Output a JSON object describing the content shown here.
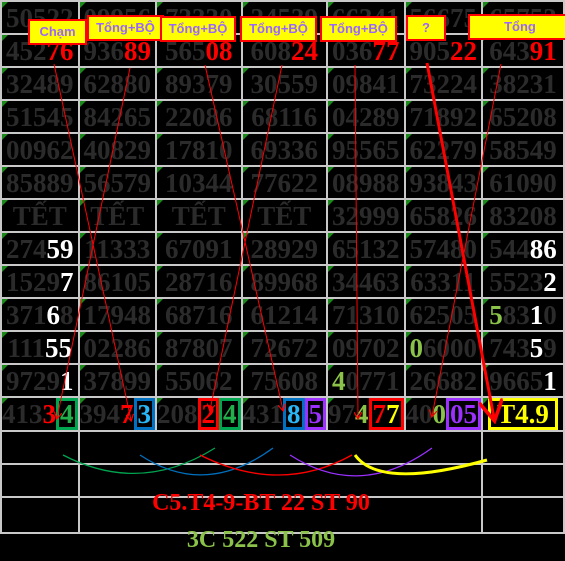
{
  "grid": [
    [
      [
        "50522"
      ],
      [
        "09956"
      ],
      [
        "73330"
      ],
      [
        "24539"
      ],
      [
        "66341"
      ],
      [
        "56675"
      ],
      [
        "65753"
      ]
    ],
    [
      [
        "452",
        ""
      ],
      [
        "936",
        ""
      ],
      [
        "565",
        ""
      ],
      [
        "608",
        ""
      ],
      [
        "036",
        ""
      ],
      [
        "905",
        ""
      ],
      [
        "643",
        ""
      ]
    ],
    [
      [
        "32489"
      ],
      [
        "62880"
      ],
      [
        "89379"
      ],
      [
        "30559"
      ],
      [
        "09841"
      ],
      [
        "73224"
      ],
      [
        "38231"
      ]
    ],
    [
      [
        "51545"
      ],
      [
        "84265"
      ],
      [
        "22086"
      ],
      [
        "68116"
      ],
      [
        "04289"
      ],
      [
        "71892"
      ],
      [
        "65208"
      ]
    ],
    [
      [
        "00962"
      ],
      [
        "40829"
      ],
      [
        "17810"
      ],
      [
        "69336"
      ],
      [
        "95565"
      ],
      [
        "62279"
      ],
      [
        "58549"
      ]
    ],
    [
      [
        "85889"
      ],
      [
        "56579"
      ],
      [
        "10344"
      ],
      [
        "77622"
      ],
      [
        "08988"
      ],
      [
        "93843"
      ],
      [
        "61090"
      ]
    ],
    [
      [
        "TẾT"
      ],
      [
        "TẾT"
      ],
      [
        "TẾT"
      ],
      [
        "TẾT"
      ],
      [
        "32999"
      ],
      [
        "65826"
      ],
      [
        "83208"
      ]
    ]
  ],
  "highlights": {
    "c1": "76",
    "c2": "89",
    "c3": "08",
    "c4": "24",
    "c5": "77",
    "c6": "22",
    "c7": "91"
  },
  "rows2": {
    "r7": {
      "c1a": "274",
      "c1b": "59",
      "c2": "11333",
      "c3": "67091",
      "c4": "28929",
      "c5": "65132",
      "c6": "57480",
      "c7a": "544",
      "c7b": "86"
    },
    "r8": {
      "c1a": "1529",
      "c1b": "7",
      "c2": "86105",
      "c3": "28716",
      "c4": "89968",
      "c5": "34463",
      "c6": "63311",
      "c7a": "5523",
      "c7b": "2"
    },
    "r9": {
      "c1a": "371",
      "c1b": "6",
      "c1c": "8",
      "c2": "17948",
      "c3": "68716",
      "c4": "61214",
      "c5": "71310",
      "c6": "62505",
      "c7a": "5",
      "c7b": "83",
      "c7c": "1",
      "c7d": "0"
    },
    "r10": {
      "c1a": "111",
      "c1b": "55",
      "c2": "02286",
      "c3": "87807",
      "c4": "72672",
      "c5": "09702",
      "c6a": "0",
      "c6b": "6000",
      "c7a": "743",
      "c7b": "5",
      "c7c": "9"
    },
    "r11": {
      "c1a": "9729",
      "c1b": "1",
      "c2": "37899",
      "c3": "55062",
      "c4": "75608",
      "c5a": "4",
      "c5b": "0771",
      "c6": "26682",
      "c7a": "9665",
      "c7b": "1"
    },
    "r12": {
      "c1a": "413",
      "c1b": "3",
      "c1c": "4",
      "c2a": "394",
      "c2b": "7",
      "c2c": "3",
      "c3a": "208",
      "c3b": "2",
      "c3c": "4",
      "c4a": "431",
      "c4b": "8",
      "c4c": "5",
      "c5a": "97",
      "c5b": "4",
      "c5c": "7",
      "c5d": "7",
      "c6a": "40",
      "c6b": "0",
      "c6c": "05",
      "c7": "T4.9"
    }
  },
  "labels": [
    "Chạm",
    "Tổng+BỘ",
    "Tổng+BỘ",
    "Tổng+BỘ",
    "Tổng+BỘ",
    "?",
    "Tổng"
  ],
  "footer": {
    "line1": "C5.T4-9-BT 22 ST 90",
    "line2": "3C 522 ST 509"
  },
  "colors": {
    "highlight": "#ff0000",
    "label_bg": "#ffff00",
    "label_text": "#9966ff",
    "footer2": "#8bc34a"
  }
}
